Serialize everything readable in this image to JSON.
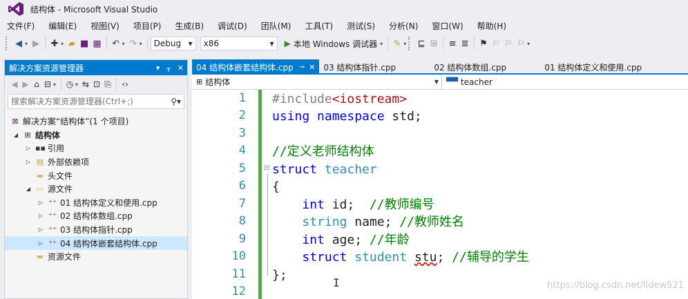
{
  "window": {
    "title": "结构体 - Microsoft Visual Studio"
  },
  "menu": {
    "items": [
      "文件(F)",
      "编辑(E)",
      "视图(V)",
      "项目(P)",
      "生成(B)",
      "调试(D)",
      "团队(M)",
      "工具(T)",
      "测试(S)",
      "分析(N)",
      "窗口(W)",
      "帮助(H)"
    ]
  },
  "toolbar": {
    "config": "Debug",
    "platform": "x86",
    "run_label": "本地 Windows 调试器"
  },
  "solution_explorer": {
    "title": "解决方案资源管理器",
    "search_placeholder": "搜索解决方案资源管理器(Ctrl+;)",
    "tree": [
      {
        "label": "解决方案“结构体”(1 个项目)",
        "icon": "solution-icon"
      },
      {
        "label": "结构体",
        "icon": "project-icon"
      },
      {
        "label": "引用",
        "icon": "references-icon"
      },
      {
        "label": "外部依赖项",
        "icon": "external-deps-icon"
      },
      {
        "label": "头文件",
        "icon": "folder-icon"
      },
      {
        "label": "源文件",
        "icon": "folder-icon"
      },
      {
        "label": "01 结构体定义和使用.cpp",
        "icon": "cpp-file-icon"
      },
      {
        "label": "02 结构体数组.cpp",
        "icon": "cpp-file-icon"
      },
      {
        "label": "03 结构体指针.cpp",
        "icon": "cpp-file-icon"
      },
      {
        "label": "04 结构体嵌套结构体.cpp",
        "icon": "cpp-file-icon"
      },
      {
        "label": "资源文件",
        "icon": "folder-icon"
      }
    ]
  },
  "tabs": [
    {
      "label": "04 结构体嵌套结构体.cpp",
      "active": true
    },
    {
      "label": "03 结构体指针.cpp",
      "active": false
    },
    {
      "label": "02 结构体数组.cpp",
      "active": false
    },
    {
      "label": "01 结构体定义和使用.cpp",
      "active": false
    }
  ],
  "navbar": {
    "scope": "结构体",
    "member": "teacher"
  },
  "editor": {
    "line_numbers": [
      "1",
      "2",
      "3",
      "4",
      "5",
      "6",
      "7",
      "8",
      "9",
      "10",
      "11",
      "12"
    ],
    "lines": {
      "l1_pp": "#include",
      "l1_hdr": "<iostream>",
      "l2_kw1": "using",
      "l2_kw2": "namespace",
      "l2_rest": " std;",
      "l4_cm": "//定义老师结构体",
      "l5_kw": "struct",
      "l5_ty": "teacher",
      "l6": "{",
      "l7_kw": "int",
      "l7_rest": " id;  ",
      "l7_cm": "//教师编号",
      "l8_ty": "string",
      "l8_rest": " name; ",
      "l8_cm": "//教师姓名",
      "l9_kw": "int",
      "l9_rest": " age; ",
      "l9_cm": "//年龄",
      "l10_kw": "struct",
      "l10_ty": "student",
      "l10_var": "stu",
      "l10_rest": "; ",
      "l10_cm": "//辅导的学生",
      "l11": "};"
    },
    "cursor": "I",
    "watermark": "https://blog.csdn.net/lldew521"
  }
}
